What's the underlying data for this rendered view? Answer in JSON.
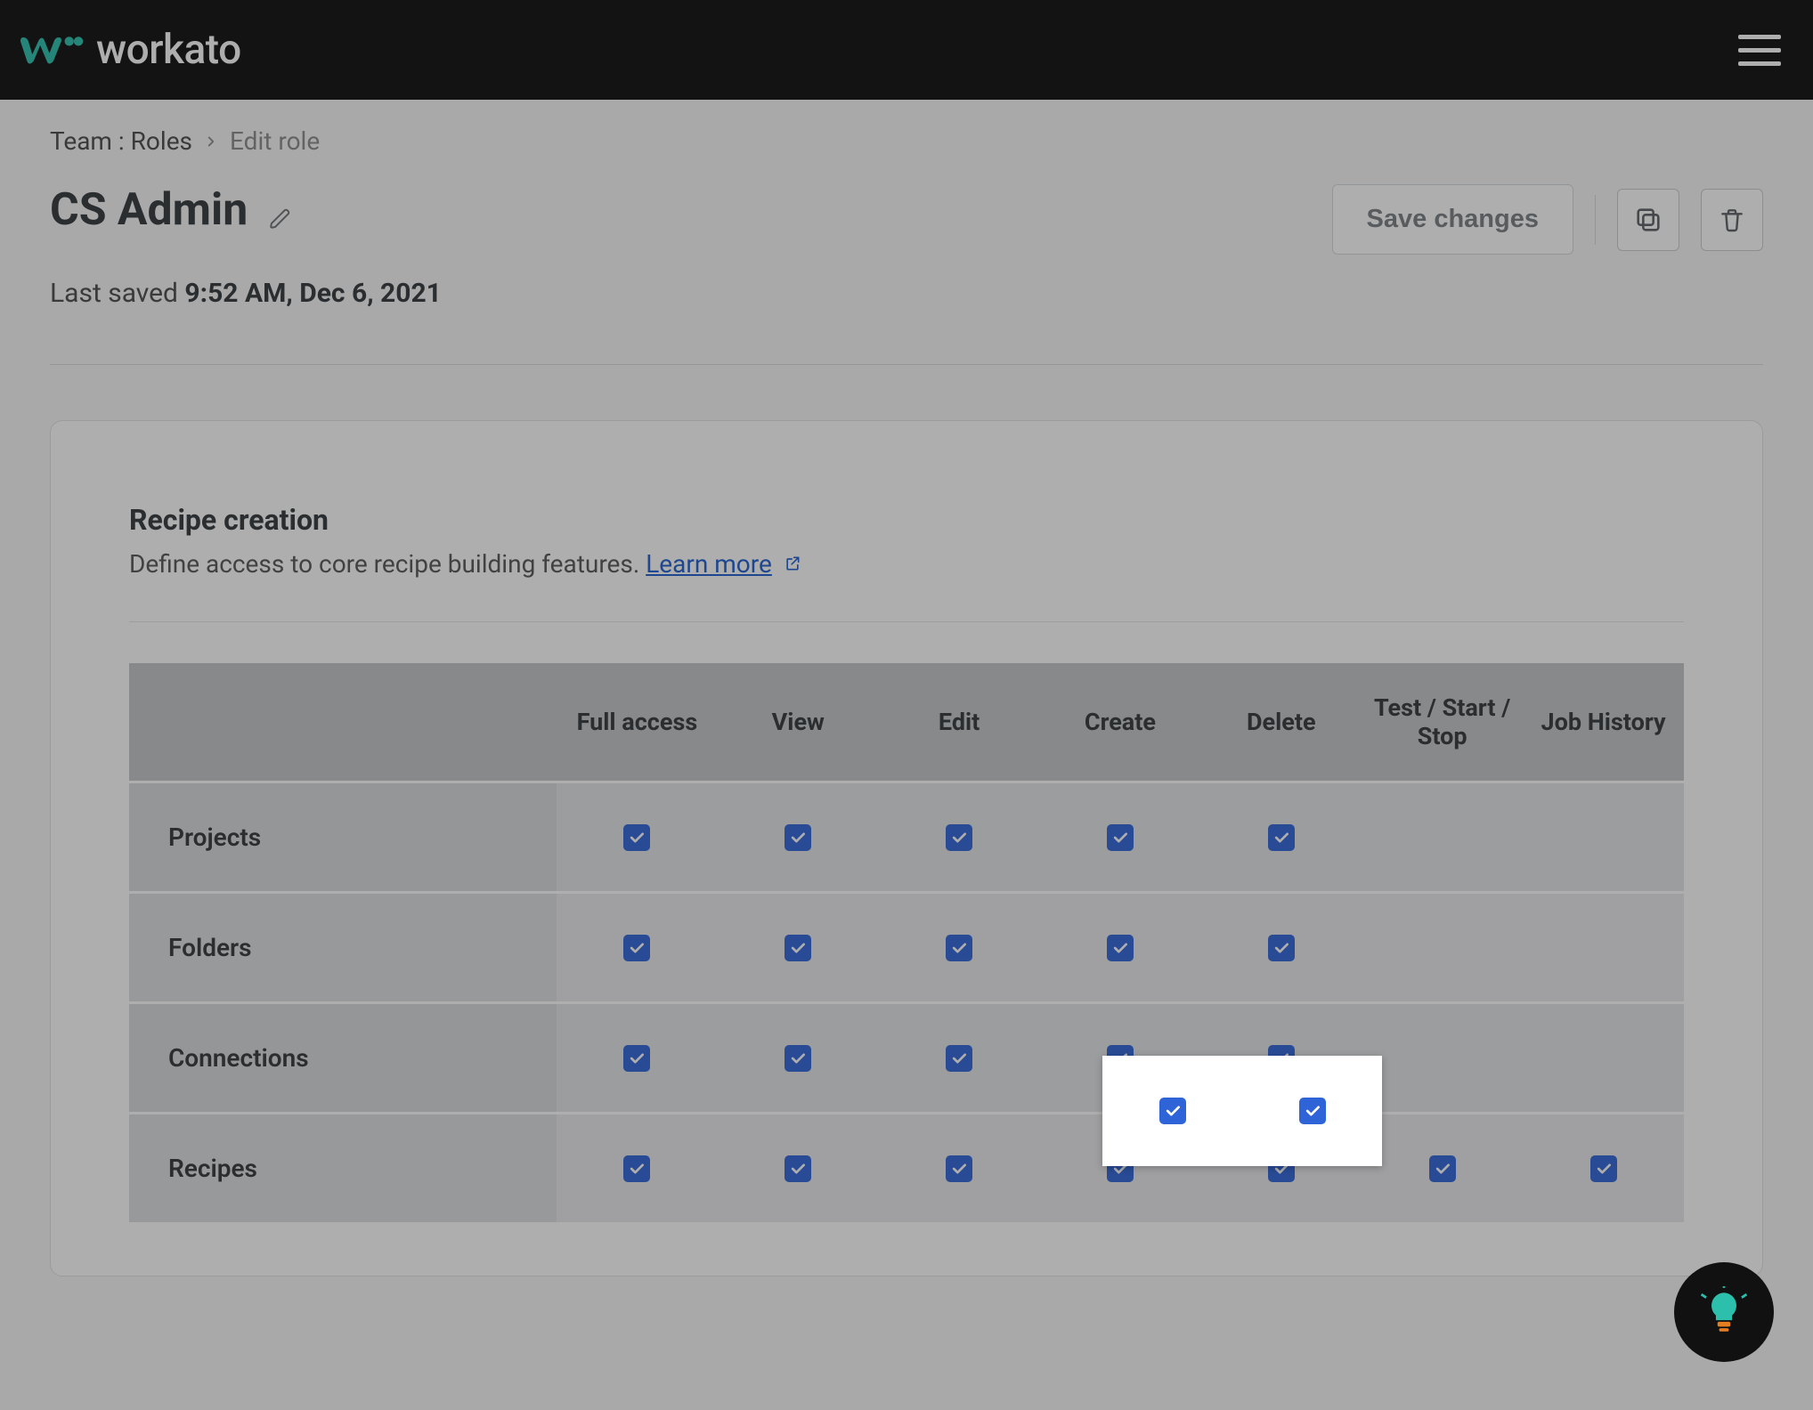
{
  "brand": {
    "name": "workato"
  },
  "breadcrumb": {
    "root": "Team : Roles",
    "current": "Edit role"
  },
  "header": {
    "title": "CS Admin",
    "saved_prefix": "Last saved ",
    "saved_time": "9:52 AM, Dec 6, 2021"
  },
  "actions": {
    "save_label": "Save changes"
  },
  "section": {
    "title": "Recipe creation",
    "subtitle": "Define access to core recipe building features. ",
    "learn_more": "Learn more"
  },
  "table": {
    "columns": [
      "",
      "Full access",
      "View",
      "Edit",
      "Create",
      "Delete",
      "Test / Start / Stop",
      "Job History"
    ],
    "rows": [
      {
        "label": "Projects",
        "cells": [
          true,
          true,
          true,
          true,
          true,
          null,
          null
        ]
      },
      {
        "label": "Folders",
        "cells": [
          true,
          true,
          true,
          true,
          true,
          null,
          null
        ]
      },
      {
        "label": "Connections",
        "cells": [
          true,
          true,
          true,
          true,
          true,
          null,
          null
        ]
      },
      {
        "label": "Recipes",
        "cells": [
          true,
          true,
          true,
          true,
          true,
          true,
          true
        ]
      }
    ]
  }
}
